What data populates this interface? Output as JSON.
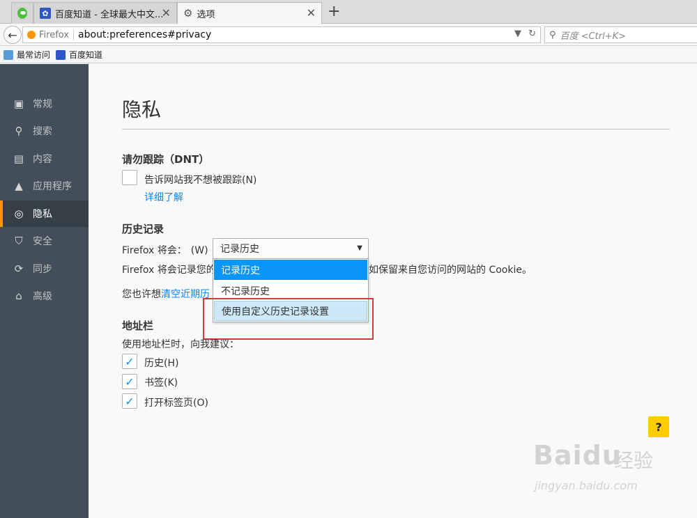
{
  "tabs": [
    {
      "title": "",
      "icon": "wechat-icon"
    },
    {
      "title": "百度知道 - 全球最大中文...",
      "icon": "baidu-paw-icon"
    },
    {
      "title": "选项",
      "icon": "gear-icon",
      "active": true
    }
  ],
  "navbar": {
    "identity": "Firefox",
    "url": "about:preferences#privacy",
    "search_placeholder": "百度 <Ctrl+K>"
  },
  "bookmarks": [
    {
      "label": "最常访问",
      "icon": "folder-icon"
    },
    {
      "label": "百度知道",
      "icon": "baidu-paw-icon"
    }
  ],
  "sidebar": {
    "items": [
      {
        "label": "常规",
        "icon": "general-icon"
      },
      {
        "label": "搜索",
        "icon": "search-icon"
      },
      {
        "label": "内容",
        "icon": "content-icon"
      },
      {
        "label": "应用程序",
        "icon": "applications-icon"
      },
      {
        "label": "隐私",
        "icon": "privacy-mask-icon",
        "selected": true
      },
      {
        "label": "安全",
        "icon": "security-icon"
      },
      {
        "label": "同步",
        "icon": "sync-icon"
      },
      {
        "label": "高级",
        "icon": "advanced-icon"
      }
    ]
  },
  "main": {
    "title": "隐私",
    "dnt": {
      "heading": "请勿跟踪（DNT）",
      "checkbox_label": "告诉网站我不想被跟踪(N)",
      "checked": false,
      "learn_more": "详细了解"
    },
    "history": {
      "heading": "历史记录",
      "will_label": "Firefox 将会：",
      "accesskey": "(W)",
      "selected": "记录历史",
      "options": [
        "记录历史",
        "不记录历史",
        "使用自定义历史记录设置"
      ],
      "desc_left": "Firefox 将会记录您的",
      "desc_right": "如保留来自您访问的网站的 Cookie。",
      "also_prefix": "您也许想",
      "also_link": "清空近期历"
    },
    "locationbar": {
      "heading": "地址栏",
      "intro": "使用地址栏时，向我建议：",
      "options": [
        {
          "label": "历史(H)",
          "checked": true
        },
        {
          "label": "书签(K)",
          "checked": true
        },
        {
          "label": "打开标签页(O)",
          "checked": true
        }
      ]
    },
    "help_label": "?"
  },
  "watermark": {
    "brand": "Baidu",
    "cn": "经验",
    "url": "jingyan.baidu.com"
  },
  "colors": {
    "sidebar_bg": "#424f5a",
    "sidebar_selected": "#343f48",
    "accent_orange": "#ff9500",
    "highlight_blue": "#0996f8",
    "annotation_red": "#d53a3a",
    "help_yellow": "#ffcc00"
  }
}
